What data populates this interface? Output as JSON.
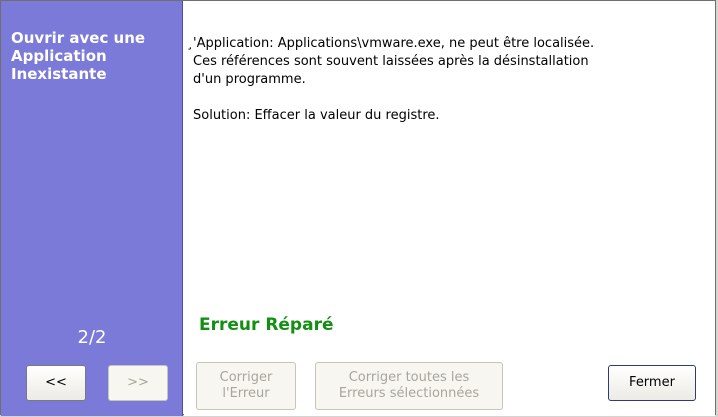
{
  "sidebar": {
    "title": "Ouvrir avec une\nApplication\nInexistante",
    "page_counter": "2/2",
    "prev_label": "<<",
    "next_label": ">>"
  },
  "main": {
    "message": "̧'Application: Applications\\vmware.exe, ne peut être localisée.\nCes références sont souvent laissées après la désinstallation\nd'un programme.\n\nSolution: Effacer la valeur du registre.",
    "status": "Erreur Réparé"
  },
  "buttons": {
    "fix_error": "Corriger\nl'Erreur",
    "fix_all": "Corriger toutes les\nErreurs sélectionnées",
    "close": "Fermer"
  },
  "colors": {
    "sidebar_bg": "#7b7ad8",
    "status_green": "#138f13"
  }
}
